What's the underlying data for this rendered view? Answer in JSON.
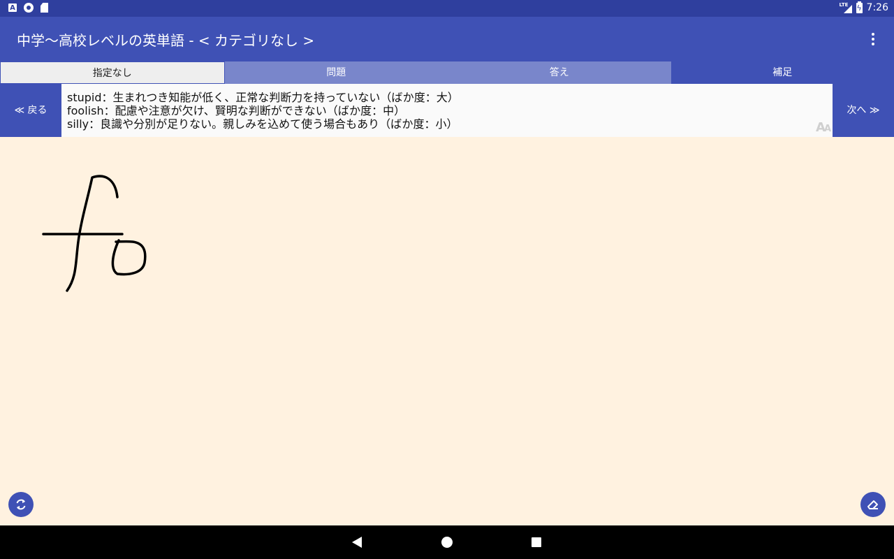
{
  "status_bar": {
    "time": "7:26",
    "network_label": "LTE",
    "left_icons": [
      "app-a-icon",
      "record-icon",
      "sd-card-icon"
    ],
    "right_icons": [
      "signal-icon",
      "battery-charging-icon"
    ]
  },
  "app_bar": {
    "title": "中学〜高校レベルの英単語 - < カテゴリなし >",
    "menu_icon": "more-vert-icon"
  },
  "tabs": [
    {
      "label": "指定なし",
      "state": "normal"
    },
    {
      "label": "問題",
      "state": "normal"
    },
    {
      "label": "答え",
      "state": "normal"
    },
    {
      "label": "補足",
      "state": "selected"
    }
  ],
  "nav": {
    "back_label": "≪ 戻る",
    "next_label": "次へ ≫"
  },
  "content": {
    "lines": [
      "stupid：生まれつき知能が低く、正常な判断力を持っていない（ばか度：大）",
      "foolish：配慮や注意が欠け、賢明な判断ができない（ばか度：中）",
      "silly：良識や分別が足りない。親しみを込めて使う場合もあり（ばか度：小）"
    ],
    "font_size_icon_label": "AA"
  },
  "canvas": {
    "background": "#fff2e0",
    "stroke_color": "#000000",
    "handwriting_text": "fo"
  },
  "colors": {
    "primary": "#3f51b5",
    "primary_dark": "#2f3f9e",
    "tab_inactive": "#7986cb"
  },
  "system_nav": [
    "back-icon",
    "home-icon",
    "recents-icon"
  ]
}
